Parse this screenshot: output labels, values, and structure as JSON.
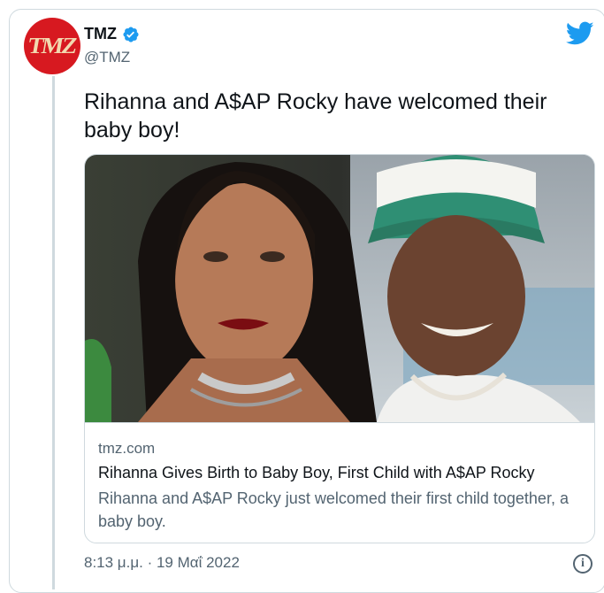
{
  "account": {
    "display_name": "TMZ",
    "handle": "@TMZ",
    "avatar_text": "TMZ",
    "verified": true
  },
  "tweet": {
    "text": "Rihanna and A$AP Rocky have welcomed their baby boy!",
    "timestamp": "8:13 μ.μ. · 19 Μαΐ 2022"
  },
  "link_card": {
    "domain": "tmz.com",
    "title": "Rihanna Gives Birth to Baby Boy, First Child with A$AP Rocky",
    "description": "Rihanna and A$AP Rocky just welcomed their first child together, a baby boy.",
    "image_alt": "Rihanna and A$AP Rocky"
  },
  "icons": {
    "verified": "verified-badge-icon",
    "platform": "twitter-bird-icon",
    "info": "info-icon"
  },
  "colors": {
    "brand_blue": "#1d9bf0",
    "tmz_red": "#d71920",
    "text_primary": "#0f1419",
    "text_secondary": "#536471",
    "border": "#cfd9de"
  }
}
